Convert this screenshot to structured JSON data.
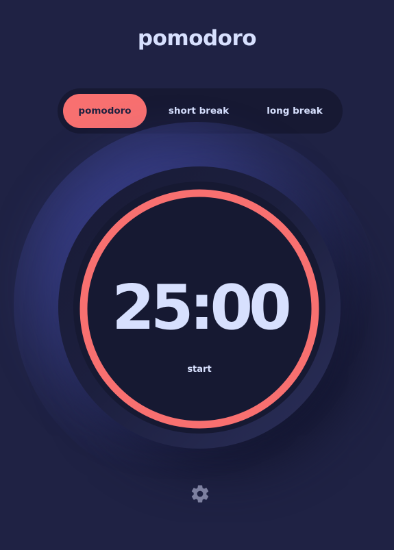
{
  "app": {
    "title": "pomodoro"
  },
  "modes": {
    "tabs": [
      {
        "label": "pomodoro",
        "active": true
      },
      {
        "label": "short break",
        "active": false
      },
      {
        "label": "long break",
        "active": false
      }
    ]
  },
  "timer": {
    "time": "25:00",
    "action_label": "start",
    "progress": 1.0
  },
  "settings": {
    "icon": "gear-icon"
  },
  "colors": {
    "accent": "#f87070",
    "background": "#1f2244",
    "text": "#d7e0fe",
    "panel": "#171933"
  }
}
